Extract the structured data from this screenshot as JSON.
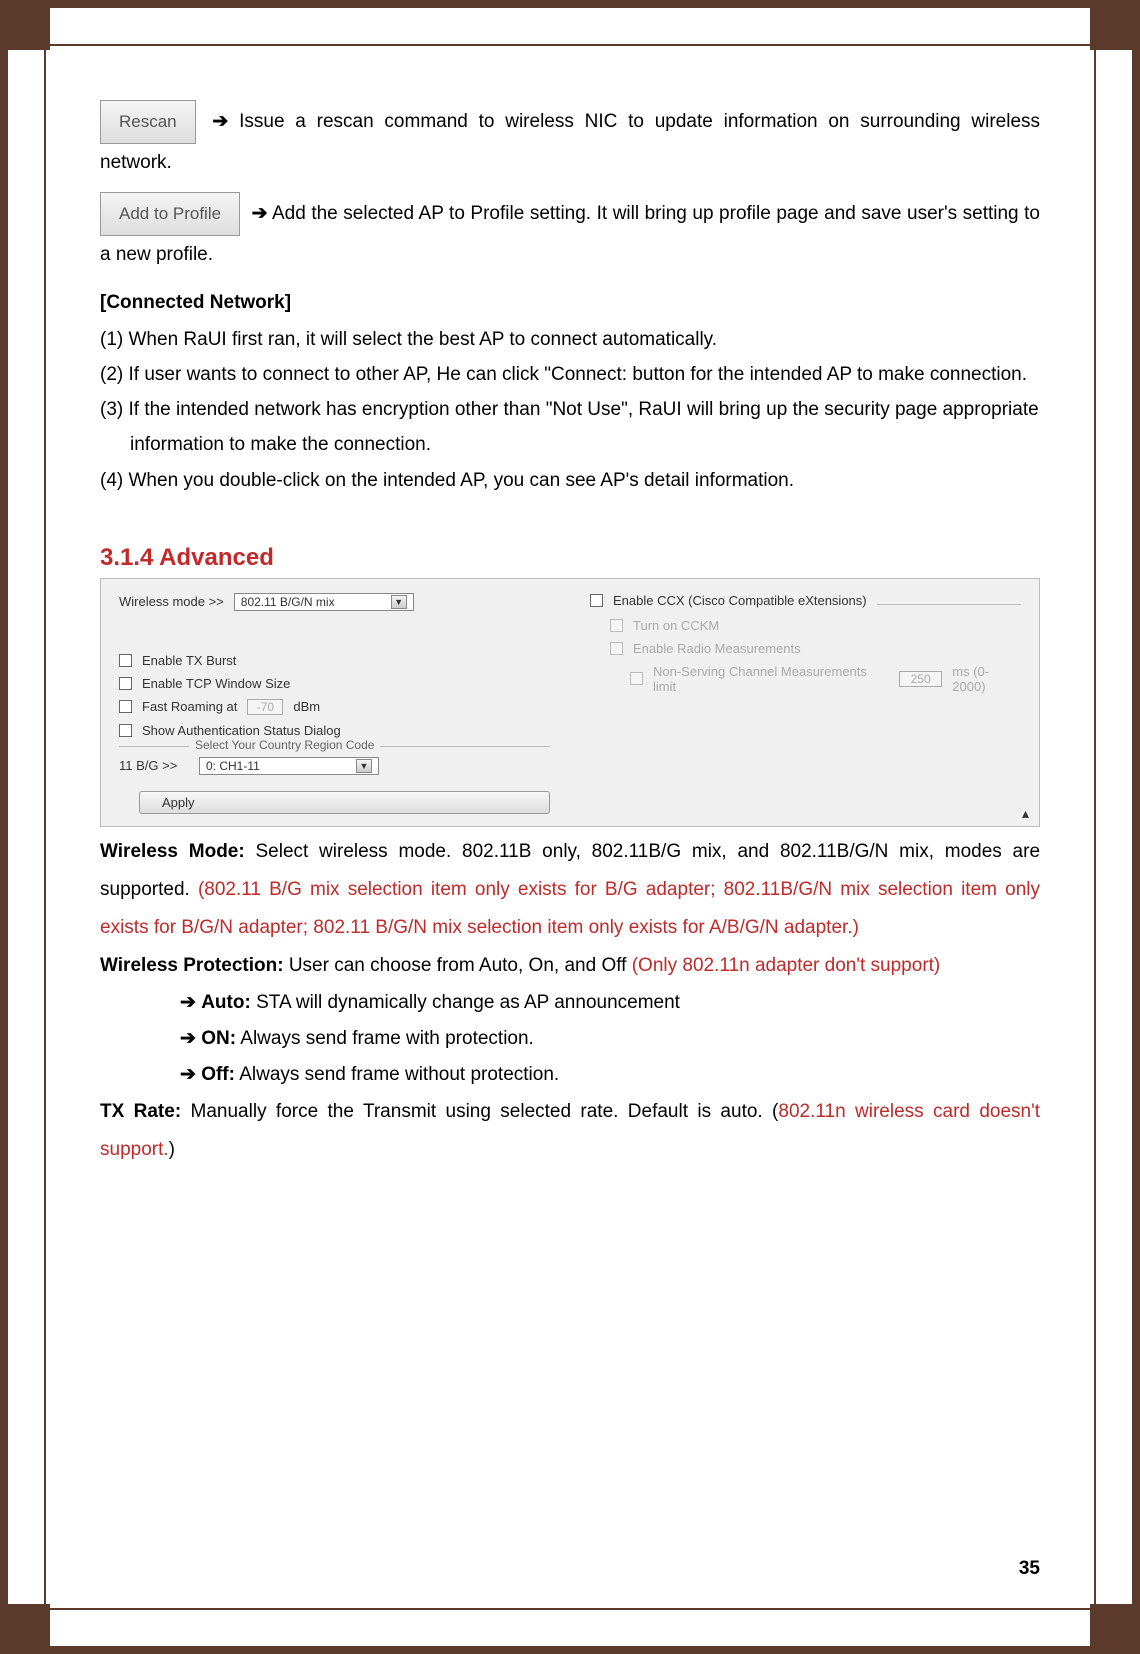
{
  "buttons": {
    "rescan": "Rescan",
    "add_to_profile": "Add to Profile"
  },
  "rescan_desc": "  Issue  a  rescan  command  to  wireless  NIC  to  update  information  on surrounding wireless network.",
  "addprofile_desc": " Add the selected AP to Profile setting. It will bring up profile page and save user's setting to a new profile.",
  "connected_heading": "[Connected Network]",
  "list": {
    "i1": "(1)  When RaUI first ran, it will select the best AP to connect automatically.",
    "i2": "(2)  If user wants to connect to other AP, He can click \"Connect: button for the intended AP to make connection.",
    "i3": "(3)  If the intended network has encryption other than \"Not Use\", RaUI will bring up the security page appropriate information to make the connection.",
    "i4": "(4)  When you double-click on the intended AP, you can see AP's detail information."
  },
  "section_heading": "3.1.4  Advanced",
  "ui": {
    "wireless_mode_label": "Wireless mode >>",
    "wireless_mode_value": "802.11 B/G/N mix",
    "enable_tx_burst": "Enable TX Burst",
    "enable_tcp_window": "Enable TCP Window Size",
    "fast_roaming": "Fast Roaming at",
    "fast_roaming_val": "-70",
    "fast_roaming_unit": "dBm",
    "show_auth": "Show Authentication Status Dialog",
    "country_code_legend": "Select Your Country Region Code",
    "bg_label": "11 B/G >>",
    "bg_value": "0: CH1-11",
    "enable_ccx": "Enable CCX (Cisco Compatible eXtensions)",
    "turn_on_cckm": "Turn on CCKM",
    "enable_radio": "Enable Radio Measurements",
    "nonserving": "Non-Serving Channel Measurements limit",
    "nonserving_val": "250",
    "nonserving_unit": "ms (0-2000)",
    "apply": "Apply"
  },
  "body": {
    "wm_label": "Wireless Mode:",
    "wm_text": " Select wireless mode. 802.11B only, 802.11B/G mix, and 802.11B/G/N mix, modes are supported. ",
    "wm_red": "(802.11 B/G mix selection item only exists for B/G adapter; 802.11B/G/N mix selection item only exists for B/G/N adapter; 802.11 B/G/N mix selection item only exists for A/B/G/N adapter.)",
    "wp_label": "Wireless Protection:",
    "wp_text": " User can choose from Auto, On, and Off ",
    "wp_red": "(Only 802.11n adapter don't support)",
    "auto_label": "Auto:",
    "auto_text": " STA will dynamically change as AP announcement",
    "on_label": "ON:",
    "on_text": " Always send frame with protection.",
    "off_label": "Off:",
    "off_text": " Always send frame without protection.",
    "tx_label": "TX Rate:",
    "tx_text": " Manually force the Transmit using selected rate. Default is auto. (",
    "tx_red": "802.11n wireless card doesn't support.",
    "tx_close": ")"
  },
  "arrow": "➔",
  "page": "35"
}
